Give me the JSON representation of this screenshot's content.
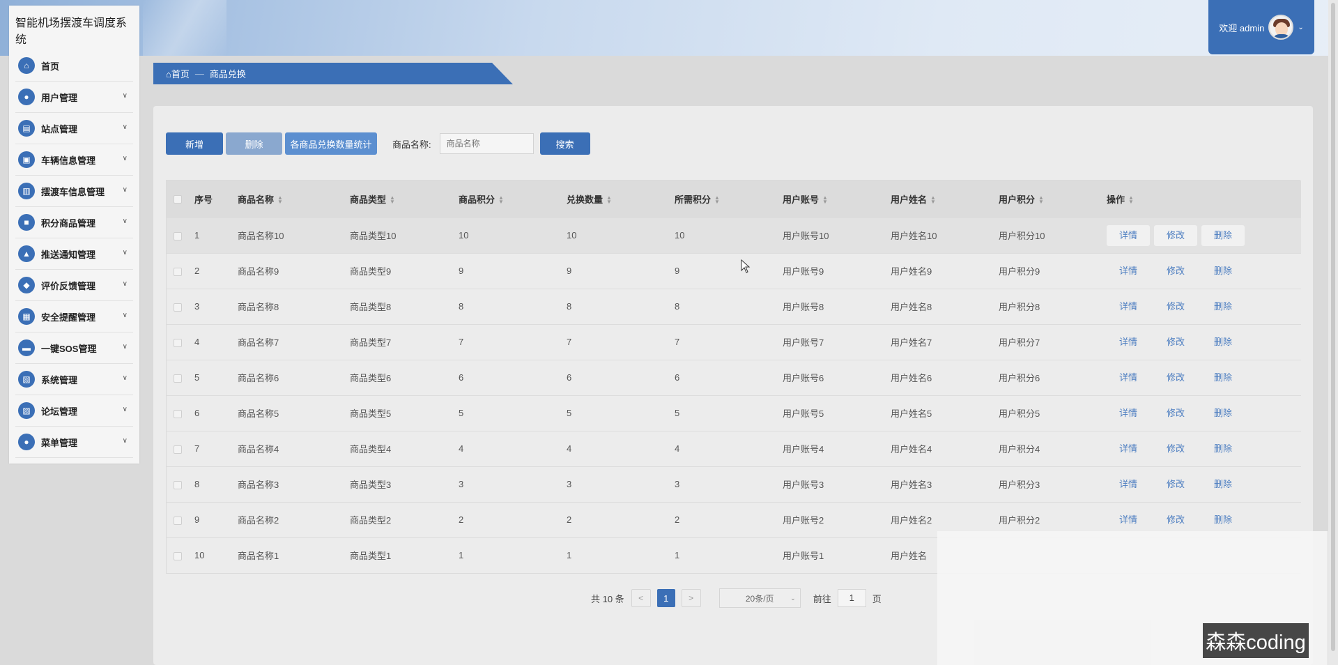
{
  "app": {
    "title": "智能机场摆渡车调度系统"
  },
  "header": {
    "welcome": "欢迎 admin"
  },
  "sidebar": {
    "items": [
      {
        "label": "首页",
        "icon": "home-icon",
        "has_children": false
      },
      {
        "label": "用户管理",
        "icon": "user-icon",
        "has_children": true
      },
      {
        "label": "站点管理",
        "icon": "station-icon",
        "has_children": true
      },
      {
        "label": "车辆信息管理",
        "icon": "vehicle-icon",
        "has_children": true
      },
      {
        "label": "摆渡车信息管理",
        "icon": "shuttle-icon",
        "has_children": true
      },
      {
        "label": "积分商品管理",
        "icon": "gift-icon",
        "has_children": true
      },
      {
        "label": "推送通知管理",
        "icon": "bell-icon",
        "has_children": true
      },
      {
        "label": "评价反馈管理",
        "icon": "feedback-icon",
        "has_children": true
      },
      {
        "label": "安全提醒管理",
        "icon": "shield-icon",
        "has_children": true
      },
      {
        "label": "一键SOS管理",
        "icon": "sos-icon",
        "has_children": true
      },
      {
        "label": "系统管理",
        "icon": "settings-icon",
        "has_children": true
      },
      {
        "label": "论坛管理",
        "icon": "forum-icon",
        "has_children": true
      },
      {
        "label": "菜单管理",
        "icon": "menu-icon",
        "has_children": true
      }
    ]
  },
  "breadcrumb": {
    "home": "首页",
    "separator": "—",
    "current": "商品兑换"
  },
  "toolbar": {
    "add_label": "新增",
    "delete_label": "删除",
    "stats_label": "各商品兑换数量统计",
    "search_label": "商品名称:",
    "search_placeholder": "商品名称",
    "search_button": "搜索"
  },
  "table": {
    "columns": [
      "序号",
      "商品名称",
      "商品类型",
      "商品积分",
      "兑换数量",
      "所需积分",
      "用户账号",
      "用户姓名",
      "用户积分",
      "操作"
    ],
    "actions": [
      "详情",
      "修改",
      "删除"
    ],
    "rows": [
      [
        "1",
        "商品名称10",
        "商品类型10",
        "10",
        "10",
        "10",
        "用户账号10",
        "用户姓名10",
        "用户积分10"
      ],
      [
        "2",
        "商品名称9",
        "商品类型9",
        "9",
        "9",
        "9",
        "用户账号9",
        "用户姓名9",
        "用户积分9"
      ],
      [
        "3",
        "商品名称8",
        "商品类型8",
        "8",
        "8",
        "8",
        "用户账号8",
        "用户姓名8",
        "用户积分8"
      ],
      [
        "4",
        "商品名称7",
        "商品类型7",
        "7",
        "7",
        "7",
        "用户账号7",
        "用户姓名7",
        "用户积分7"
      ],
      [
        "5",
        "商品名称6",
        "商品类型6",
        "6",
        "6",
        "6",
        "用户账号6",
        "用户姓名6",
        "用户积分6"
      ],
      [
        "6",
        "商品名称5",
        "商品类型5",
        "5",
        "5",
        "5",
        "用户账号5",
        "用户姓名5",
        "用户积分5"
      ],
      [
        "7",
        "商品名称4",
        "商品类型4",
        "4",
        "4",
        "4",
        "用户账号4",
        "用户姓名4",
        "用户积分4"
      ],
      [
        "8",
        "商品名称3",
        "商品类型3",
        "3",
        "3",
        "3",
        "用户账号3",
        "用户姓名3",
        "用户积分3"
      ],
      [
        "9",
        "商品名称2",
        "商品类型2",
        "2",
        "2",
        "2",
        "用户账号2",
        "用户姓名2",
        "用户积分2"
      ],
      [
        "10",
        "商品名称1",
        "商品类型1",
        "1",
        "1",
        "1",
        "用户账号1",
        "用户姓名",
        "",
        ""
      ]
    ]
  },
  "pagination": {
    "total": "共 10 条",
    "prev": "<",
    "current": "1",
    "next": ">",
    "page_size": "20条/页",
    "goto_label": "前往",
    "goto_value": "1",
    "page_suffix": "页"
  },
  "watermark": "森森coding",
  "colors": {
    "primary": "#3b6fb6",
    "delete_disabled": "#8aa8cf",
    "stats": "#5c8fd0",
    "link": "#4a7cc0"
  }
}
